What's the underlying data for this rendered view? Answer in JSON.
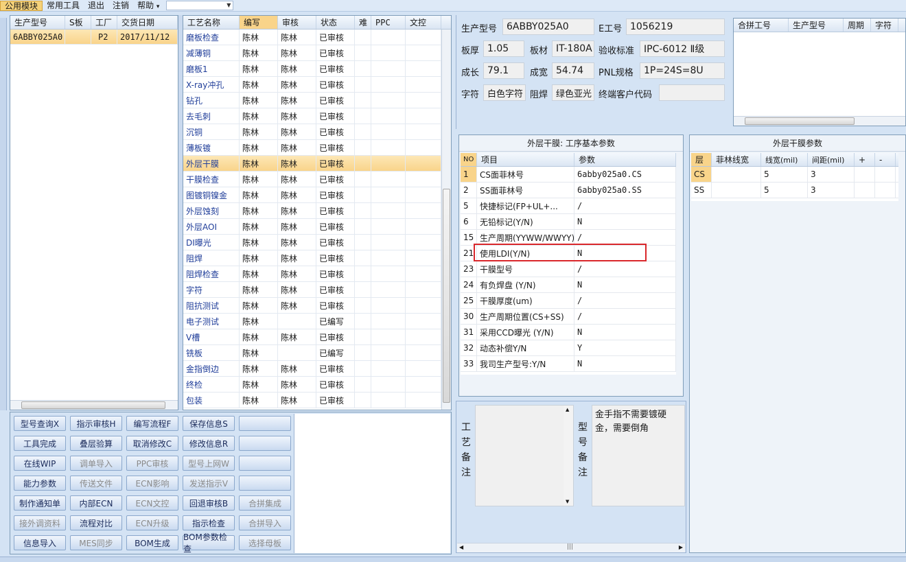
{
  "menubar": {
    "items": [
      "公用模块",
      "常用工具",
      "退出",
      "注销",
      "帮助"
    ],
    "help_arrow": "▾"
  },
  "left_grid": {
    "headers": [
      "生产型号",
      "S板",
      "工厂",
      "交货日期"
    ],
    "rows": [
      [
        "6ABBY025A0",
        "",
        "P2",
        "2017/11/12"
      ]
    ]
  },
  "process_grid": {
    "headers": [
      "工艺名称",
      "编写",
      "审核",
      "状态",
      "难",
      "PPC",
      "文控"
    ],
    "rows": [
      [
        "磨板检查",
        "陈林",
        "陈林",
        "已审核"
      ],
      [
        "减薄铜",
        "陈林",
        "陈林",
        "已审核"
      ],
      [
        "磨板1",
        "陈林",
        "陈林",
        "已审核"
      ],
      [
        "X-ray冲孔",
        "陈林",
        "陈林",
        "已审核"
      ],
      [
        "钻孔",
        "陈林",
        "陈林",
        "已审核"
      ],
      [
        "去毛刺",
        "陈林",
        "陈林",
        "已审核"
      ],
      [
        "沉铜",
        "陈林",
        "陈林",
        "已审核"
      ],
      [
        "薄板镀",
        "陈林",
        "陈林",
        "已审核"
      ],
      [
        "外层干膜",
        "陈林",
        "陈林",
        "已审核"
      ],
      [
        "干膜检查",
        "陈林",
        "陈林",
        "已审核"
      ],
      [
        "图镀铜镍金",
        "陈林",
        "陈林",
        "已审核"
      ],
      [
        "外层蚀刻",
        "陈林",
        "陈林",
        "已审核"
      ],
      [
        "外层AOI",
        "陈林",
        "陈林",
        "已审核"
      ],
      [
        "DI曝光",
        "陈林",
        "陈林",
        "已审核"
      ],
      [
        "阻焊",
        "陈林",
        "陈林",
        "已审核"
      ],
      [
        "阻焊检查",
        "陈林",
        "陈林",
        "已审核"
      ],
      [
        "字符",
        "陈林",
        "陈林",
        "已审核"
      ],
      [
        "阻抗测试",
        "陈林",
        "陈林",
        "已审核"
      ],
      [
        "电子测试",
        "陈林",
        "",
        "已编写"
      ],
      [
        "V槽",
        "陈林",
        "陈林",
        "已审核"
      ],
      [
        "铣板",
        "陈林",
        "",
        "已编写"
      ],
      [
        "金指倒边",
        "陈林",
        "陈林",
        "已审核"
      ],
      [
        "终检",
        "陈林",
        "陈林",
        "已审核"
      ],
      [
        "包装",
        "陈林",
        "陈林",
        "已审核"
      ]
    ]
  },
  "buttons": [
    [
      "型号查询X",
      "指示审核H",
      "编写流程F",
      "保存信息S",
      ""
    ],
    [
      "工具完成",
      "叠层验算",
      "取消修改C",
      "修改信息R",
      ""
    ],
    [
      "在线WIP",
      "调单导入",
      "PPC审核",
      "型号上网W",
      ""
    ],
    [
      "能力参数",
      "传送文件",
      "ECN影响",
      "发送指示V",
      ""
    ],
    [
      "制作通知单",
      "内部ECN",
      "ECN文控",
      "回退审核B",
      "合拼集成"
    ],
    [
      "接外调资料",
      "流程对比",
      "ECN升级",
      "指示检查",
      "合拼导入"
    ],
    [
      "信息导入",
      "MES同步",
      "BOM生成",
      "BOM参数检查",
      "选择母板"
    ]
  ],
  "button_disabled": [
    [
      false,
      false,
      false,
      false,
      false
    ],
    [
      false,
      false,
      false,
      false,
      false
    ],
    [
      false,
      true,
      true,
      true,
      false
    ],
    [
      false,
      true,
      true,
      true,
      false
    ],
    [
      false,
      false,
      true,
      false,
      true
    ],
    [
      true,
      false,
      true,
      false,
      true
    ],
    [
      false,
      true,
      false,
      false,
      true
    ]
  ],
  "info": {
    "prod_model_label": "生产型号",
    "prod_model": "6ABBY025A0",
    "e_no_label": "E工号",
    "e_no": "1056219",
    "thick_label": "板厚",
    "thick": "1.05",
    "material_label": "板材",
    "material": "IT-180A",
    "std_label": "验收标准",
    "std": "IPC-6012 Ⅱ级",
    "len_label": "成长",
    "len": "79.1",
    "wid_label": "成宽",
    "wid": "54.74",
    "pnl_label": "PNL规格",
    "pnl": "1P=24S=8U",
    "char_label": "字符",
    "char": "白色字符",
    "mask_label": "阻焊",
    "mask": "绿色亚光",
    "cust_label": "终端客户代码",
    "cust": ""
  },
  "merge_grid": {
    "headers": [
      "合拼工号",
      "生产型号",
      "周期",
      "字符"
    ]
  },
  "param_panel": {
    "title": "外层干膜: 工序基本参数",
    "headers": [
      "NO",
      "项目",
      "参数"
    ],
    "rows": [
      [
        "1",
        "CS面菲林号",
        "6abby025a0.CS"
      ],
      [
        "2",
        "SS面菲林号",
        "6abby025a0.SS"
      ],
      [
        "5",
        "快捷标记(FP+UL+...",
        "/"
      ],
      [
        "6",
        "无铅标记(Y/N)",
        "N"
      ],
      [
        "15",
        "生产周期(YYWW/WWYY)",
        "/"
      ],
      [
        "21",
        "使用LDI(Y/N)",
        "N"
      ],
      [
        "23",
        "干膜型号",
        "/"
      ],
      [
        "24",
        "有负焊盘 (Y/N)",
        "N"
      ],
      [
        "25",
        "干膜厚度(um)",
        "/"
      ],
      [
        "30",
        "生产周期位置(CS+SS)",
        "/"
      ],
      [
        "31",
        "采用CCD曝光 (Y/N)",
        "N"
      ],
      [
        "32",
        "动态补偿Y/N",
        "Y"
      ],
      [
        "33",
        "我司生产型号:Y/N",
        "N"
      ]
    ]
  },
  "film_panel": {
    "title": "外层干膜参数",
    "headers": [
      "层",
      "菲林线宽",
      "线宽(mil)",
      "间距(mil)",
      "+",
      "-"
    ],
    "rows": [
      [
        "CS",
        "",
        "5",
        "3",
        "",
        ""
      ],
      [
        "SS",
        "",
        "5",
        "3",
        "",
        ""
      ]
    ]
  },
  "notes": {
    "process_label": "工艺备注",
    "model_label": "型号备注",
    "process_note": "",
    "model_note": "金手指不需要镀硬金，需要倒角"
  },
  "colors": {
    "highlight_box": "#d9262a",
    "selected_row": "#f9d48a",
    "accent": "#1f3d99"
  }
}
